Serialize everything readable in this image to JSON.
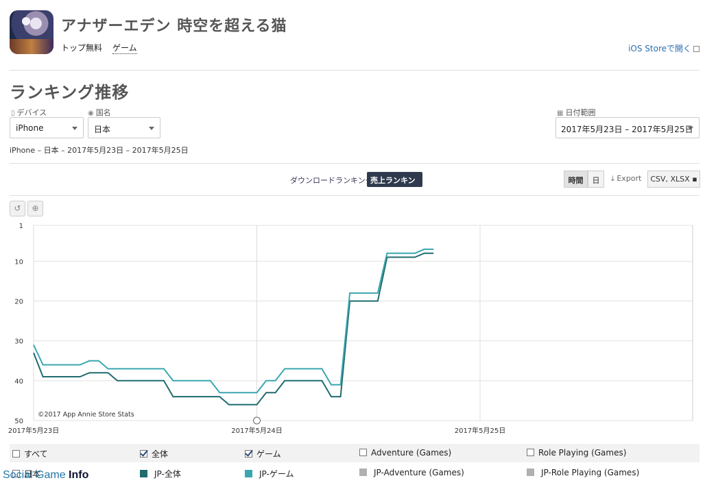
{
  "app": {
    "title": "アナザーエデン 時空を超える猫",
    "breadcrumbs": [
      "トップ無料",
      "ゲーム"
    ],
    "ios_link": "iOS Storeで開く"
  },
  "section_title": "ランキング推移",
  "filters": {
    "device": {
      "label": "デバイス",
      "value": "iPhone"
    },
    "country": {
      "label": "国名",
      "value": "日本"
    },
    "date_range": {
      "label": "日付範囲",
      "value": "2017年5月23日 – 2017年5月25日"
    }
  },
  "summary": "iPhone – 日本 – 2017年5月23日 – 2017年5月25日",
  "tabs": {
    "download": "ダウンロードランキング",
    "revenue": "売上ランキング"
  },
  "controls": {
    "hour": "時間",
    "day": "日",
    "export": "Export",
    "formats": "CSV, XLSX"
  },
  "chart_data": {
    "type": "line",
    "y_reversed": true,
    "ylim": [
      1,
      50
    ],
    "yticks": [
      "1",
      "10",
      "20",
      "30",
      "40",
      "50"
    ],
    "xticks": [
      "2017年5月23日",
      "2017年5月24日",
      "2017年5月25日"
    ],
    "copyright": "©2017 App Annie Store Stats",
    "x_unit": "hours since 2017-05-23 00:00",
    "series": [
      {
        "name": "JP-全体",
        "color": "#1f6b6e",
        "values": [
          [
            0,
            33
          ],
          [
            1,
            39
          ],
          [
            2,
            39
          ],
          [
            3,
            39
          ],
          [
            4,
            39
          ],
          [
            5,
            39
          ],
          [
            6,
            38
          ],
          [
            7,
            38
          ],
          [
            8,
            38
          ],
          [
            9,
            40
          ],
          [
            10,
            40
          ],
          [
            11,
            40
          ],
          [
            12,
            40
          ],
          [
            13,
            40
          ],
          [
            14,
            40
          ],
          [
            15,
            44
          ],
          [
            16,
            44
          ],
          [
            17,
            44
          ],
          [
            18,
            44
          ],
          [
            19,
            44
          ],
          [
            20,
            44
          ],
          [
            21,
            46
          ],
          [
            22,
            46
          ],
          [
            23,
            46
          ],
          [
            24,
            46
          ],
          [
            25,
            43
          ],
          [
            26,
            43
          ],
          [
            27,
            40
          ],
          [
            28,
            40
          ],
          [
            29,
            40
          ],
          [
            30,
            40
          ],
          [
            31,
            40
          ],
          [
            32,
            44
          ],
          [
            33,
            44
          ],
          [
            34,
            20
          ],
          [
            35,
            20
          ],
          [
            36,
            20
          ],
          [
            37,
            20
          ],
          [
            38,
            9
          ],
          [
            39,
            9
          ],
          [
            40,
            9
          ],
          [
            41,
            9
          ],
          [
            42,
            8
          ],
          [
            43,
            8
          ]
        ]
      },
      {
        "name": "JP-ゲーム",
        "color": "#3aa6b0",
        "values": [
          [
            0,
            31
          ],
          [
            1,
            36
          ],
          [
            2,
            36
          ],
          [
            3,
            36
          ],
          [
            4,
            36
          ],
          [
            5,
            36
          ],
          [
            6,
            35
          ],
          [
            7,
            35
          ],
          [
            8,
            37
          ],
          [
            9,
            37
          ],
          [
            10,
            37
          ],
          [
            11,
            37
          ],
          [
            12,
            37
          ],
          [
            13,
            37
          ],
          [
            14,
            37
          ],
          [
            15,
            40
          ],
          [
            16,
            40
          ],
          [
            17,
            40
          ],
          [
            18,
            40
          ],
          [
            19,
            40
          ],
          [
            20,
            43
          ],
          [
            21,
            43
          ],
          [
            22,
            43
          ],
          [
            23,
            43
          ],
          [
            24,
            43
          ],
          [
            25,
            40
          ],
          [
            26,
            40
          ],
          [
            27,
            37
          ],
          [
            28,
            37
          ],
          [
            29,
            37
          ],
          [
            30,
            37
          ],
          [
            31,
            37
          ],
          [
            32,
            41
          ],
          [
            33,
            41
          ],
          [
            34,
            18
          ],
          [
            35,
            18
          ],
          [
            36,
            18
          ],
          [
            37,
            18
          ],
          [
            38,
            8
          ],
          [
            39,
            8
          ],
          [
            40,
            8
          ],
          [
            41,
            8
          ],
          [
            42,
            7
          ],
          [
            43,
            7
          ]
        ]
      }
    ]
  },
  "legend": {
    "all": "すべて",
    "overall": "全体",
    "game": "ゲーム",
    "adventure": "Adventure (Games)",
    "rpg": "Role Playing (Games)",
    "country": "日本",
    "jp_overall": "JP-全体",
    "jp_game": "JP-ゲーム",
    "jp_adventure": "JP-Adventure (Games)",
    "jp_rpg": "JP-Role Playing (Games)",
    "colors": {
      "overall": "#1f6b6e",
      "game": "#3aa6b0",
      "grey": "#b0b0b0"
    }
  },
  "watermark": {
    "a": "Social Game",
    "b": "Info"
  }
}
